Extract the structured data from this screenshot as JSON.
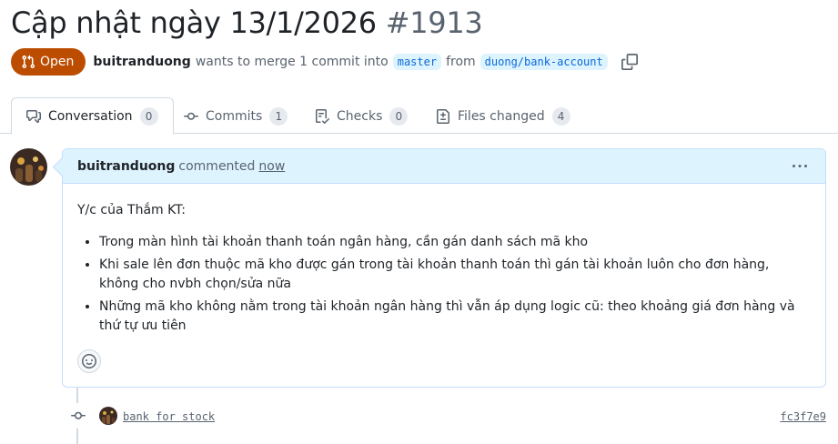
{
  "pr": {
    "title": "Cập nhật ngày 13/1/2026",
    "number": "#1913",
    "state": "Open",
    "author": "buitranduong",
    "merge_text": "wants to merge 1 commit into",
    "base_branch": "master",
    "from_text": "from",
    "head_branch": "duong/bank-account"
  },
  "tabs": [
    {
      "label": "Conversation",
      "count": "0",
      "icon": "comment-discussion-icon"
    },
    {
      "label": "Commits",
      "count": "1",
      "icon": "git-commit-icon"
    },
    {
      "label": "Checks",
      "count": "0",
      "icon": "checklist-icon"
    },
    {
      "label": "Files changed",
      "count": "4",
      "icon": "file-diff-icon"
    }
  ],
  "comment": {
    "author": "buitranduong",
    "action": "commented",
    "time": "now",
    "intro": "Y/c của Thắm KT:",
    "items": [
      "Trong màn hình tài khoản thanh toán ngân hàng, cần gán danh sách mã kho",
      "Khi sale lên đơn thuộc mã kho được gán trong tài khoản thanh toán thì gán tài khoản luôn cho đơn hàng, không cho nvbh chọn/sửa nữa",
      "Những mã kho không nằm trong tài khoản ngân hàng thì vẫn áp dụng logic cũ: theo khoảng giá đơn hàng và thứ tự ưu tiên"
    ]
  },
  "commit": {
    "message": "bank for stock",
    "sha": "fc3f7e9"
  },
  "colors": {
    "state_open": "#bc4c00",
    "link": "#0969da",
    "comment_header": "#ddf4ff"
  }
}
